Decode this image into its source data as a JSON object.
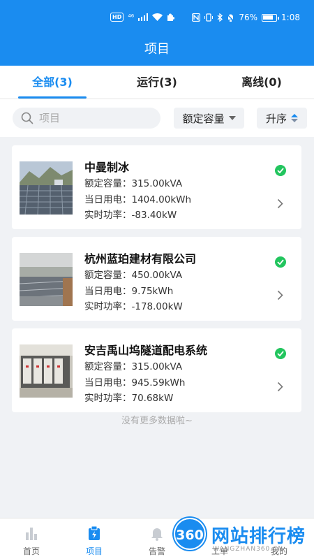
{
  "status_bar": {
    "hd": "HD",
    "signal": "⁴⁶",
    "battery_percent": "76%",
    "time": "1:08"
  },
  "header": {
    "title": "项目"
  },
  "tabs": [
    {
      "label": "全部(3)",
      "active": true
    },
    {
      "label": "运行(3)",
      "active": false
    },
    {
      "label": "离线(0)",
      "active": false
    }
  ],
  "filter": {
    "search_placeholder": "项目",
    "capacity_label": "额定容量",
    "order_label": "升序"
  },
  "projects": [
    {
      "name": "中曼制冰",
      "capacity": "额定容量：315.00kVA",
      "energy": "当日用电：1404.00kWh",
      "power": "实时功率：-83.40kW",
      "status": "running"
    },
    {
      "name": "杭州蓝珀建材有限公司",
      "capacity": "额定容量：450.00kVA",
      "energy": "当日用电：9.75kWh",
      "power": "实时功率：-178.00kW",
      "status": "running"
    },
    {
      "name": "安吉禹山坞隧道配电系统",
      "capacity": "额定容量：315.00kVA",
      "energy": "当日用电：945.59kWh",
      "power": "实时功率：70.68kW",
      "status": "running"
    }
  ],
  "list_end_text": "没有更多数据啦~",
  "bottom_nav": [
    {
      "label": "首页",
      "active": false
    },
    {
      "label": "项目",
      "active": true
    },
    {
      "label": "告警",
      "active": false
    },
    {
      "label": "工单",
      "active": false
    },
    {
      "label": "我的",
      "active": false
    }
  ],
  "watermark": {
    "badge": "360",
    "text": "网站排行榜",
    "sub": "WANGZHAN360.CN"
  },
  "colors": {
    "primary": "#1a8cf0",
    "status_online": "#22c55e"
  }
}
